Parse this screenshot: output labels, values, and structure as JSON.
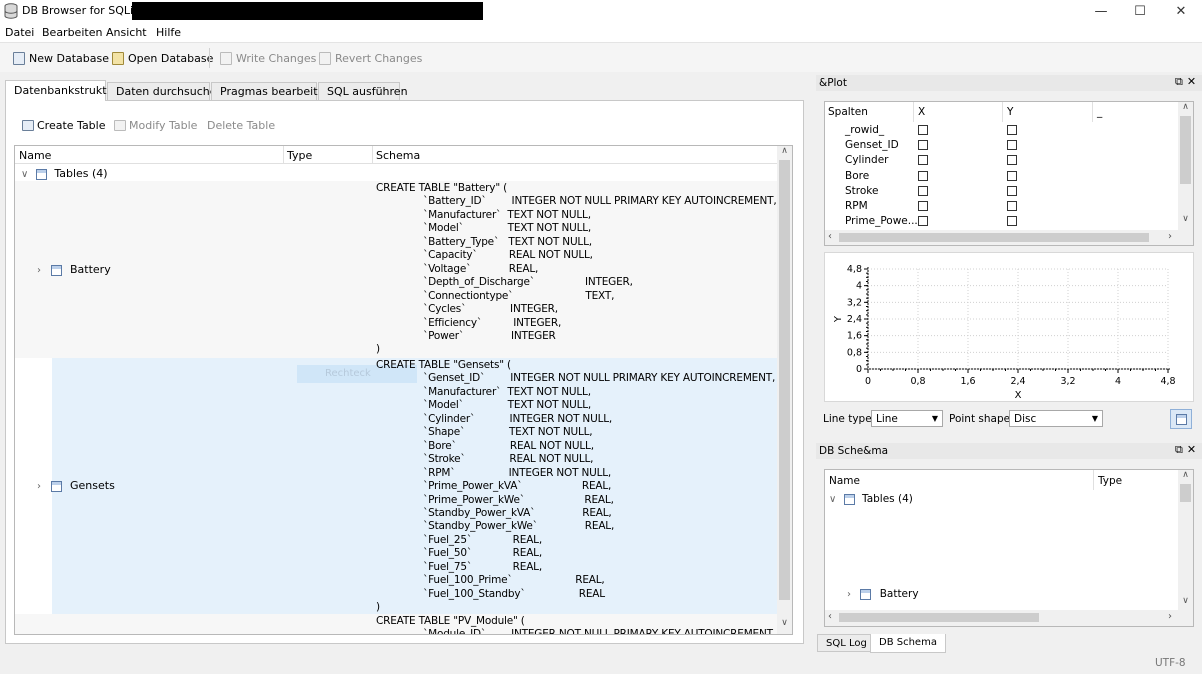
{
  "window": {
    "title": "DB Browser for SQLite -",
    "minimize": "—",
    "maximize": "☐",
    "close": "✕"
  },
  "menu": [
    "Datei",
    "Bearbeiten",
    "Ansicht",
    "Hilfe"
  ],
  "toolbar": {
    "new_db": "New Database",
    "open_db": "Open Database",
    "write": "Write Changes",
    "revert": "Revert Changes"
  },
  "tabs": [
    "Datenbankstruktur",
    "Daten durchsuchen",
    "Pragmas bearbeiten",
    "SQL ausführen"
  ],
  "structure": {
    "create_table": "Create Table",
    "modify_table": "Modify Table",
    "delete_table": "Delete Table",
    "headers": {
      "name": "Name",
      "type": "Type",
      "schema": "Schema"
    },
    "tables_node": "Tables (4)",
    "ghost_text": "Rechteck",
    "battery": {
      "name": "Battery",
      "schema": "CREATE TABLE \"Battery\" (\n               `Battery_ID`        INTEGER NOT NULL PRIMARY KEY AUTOINCREMENT,\n               `Manufacturer`  TEXT NOT NULL,\n               `Model`              TEXT NOT NULL,\n               `Battery_Type`   TEXT NOT NULL,\n               `Capacity`          REAL NOT NULL,\n               `Voltage`            REAL,\n               `Depth_of_Discharge`                INTEGER,\n               `Connectiontype`                       TEXT,\n               `Cycles`              INTEGER,\n               `Efficiency`          INTEGER,\n               `Power`               INTEGER\n)"
    },
    "gensets": {
      "name": "Gensets",
      "schema": "CREATE TABLE \"Gensets\" (\n               `Genset_ID`        INTEGER NOT NULL PRIMARY KEY AUTOINCREMENT,\n               `Manufacturer`  TEXT NOT NULL,\n               `Model`              TEXT NOT NULL,\n               `Cylinder`           INTEGER NOT NULL,\n               `Shape`              TEXT NOT NULL,\n               `Bore`                 REAL NOT NULL,\n               `Stroke`              REAL NOT NULL,\n               `RPM`                 INTEGER NOT NULL,\n               `Prime_Power_kVA`                   REAL,\n               `Prime_Power_kWe`                   REAL,\n               `Standby_Power_kVA`               REAL,\n               `Standby_Power_kWe`               REAL,\n               `Fuel_25`             REAL,\n               `Fuel_50`             REAL,\n               `Fuel_75`             REAL,\n               `Fuel_100_Prime`                    REAL,\n               `Fuel_100_Standby`                 REAL\n)"
    },
    "pv": {
      "schema": "CREATE TABLE \"PV_Module\" (\n               `Module_ID`        INTEGER NOT NULL PRIMARY KEY AUTOINCREMENT,"
    }
  },
  "plot": {
    "title": "&Plot",
    "headers": {
      "columns": "Spalten",
      "x": "X",
      "y": "Y",
      "extra": "_"
    },
    "columns": [
      "_rowid_",
      "Genset_ID",
      "Cylinder",
      "Bore",
      "Stroke",
      "RPM",
      "Prime_Powe..."
    ],
    "x_label": "X",
    "y_label": "Y",
    "x_ticks": [
      "0",
      "0,8",
      "1,6",
      "2,4",
      "3,2",
      "4",
      "4,8"
    ],
    "y_ticks": [
      "4,8",
      "4",
      "3,2",
      "2,4",
      "1,6",
      "0,8",
      "0"
    ],
    "line_type_label": "Line type:",
    "line_type_value": "Line",
    "point_shape_label": "Point shape:",
    "point_shape_value": "Disc"
  },
  "schema_dock": {
    "title": "DB Sche&ma",
    "headers": {
      "name": "Name",
      "type": "Type"
    },
    "tables_node": "Tables (4)",
    "first_table": "Battery"
  },
  "bottom_tabs": [
    "SQL Log",
    "DB Schema"
  ],
  "status": {
    "encoding": "UTF-8"
  }
}
